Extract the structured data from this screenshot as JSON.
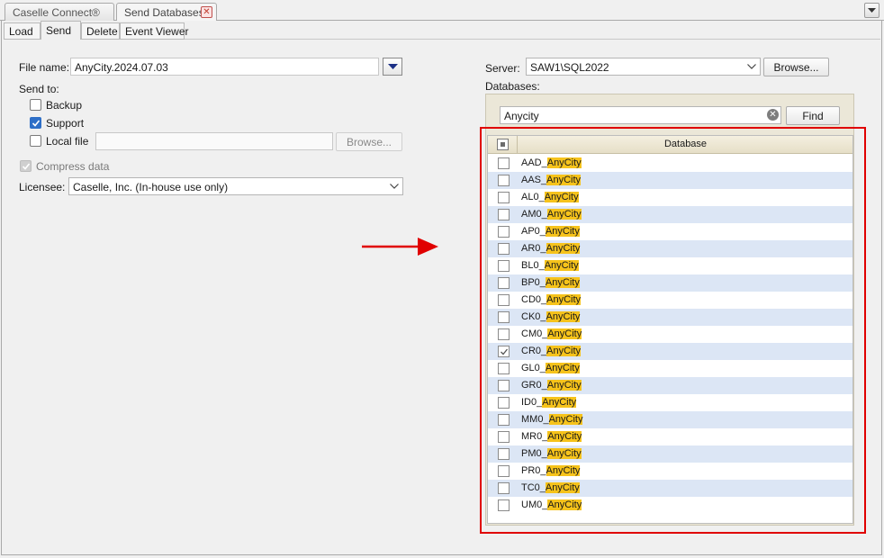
{
  "doc_tabs": [
    {
      "label": "Caselle Connect®"
    },
    {
      "label": "Send Databases"
    }
  ],
  "inner_tabs": [
    {
      "label": "Load"
    },
    {
      "label": "Send"
    },
    {
      "label": "Delete"
    },
    {
      "label": "Event Viewer"
    }
  ],
  "form": {
    "file_name_label": "File name:",
    "file_name_value": "AnyCity.2024.07.03",
    "send_to_label": "Send to:",
    "backup_label": "Backup",
    "backup_checked": false,
    "support_label": "Support",
    "support_checked": true,
    "local_file_label": "Local file",
    "local_file_checked": false,
    "local_file_value": "",
    "browse_label": "Browse...",
    "compress_label": "Compress data",
    "compress_checked": true,
    "licensee_label": "Licensee:",
    "licensee_value": "Caselle, Inc. (In-house use only)"
  },
  "server": {
    "label": "Server:",
    "value": "SAW1\\SQL2022",
    "browse_label": "Browse..."
  },
  "databases": {
    "label": "Databases:",
    "search_value": "Anycity",
    "find_label": "Find",
    "column_header": "Database",
    "highlight_color": "#f6c31b",
    "rows": [
      {
        "prefix": "AAD_",
        "match": "AnyCity",
        "checked": false
      },
      {
        "prefix": "AAS_",
        "match": "AnyCity",
        "checked": false
      },
      {
        "prefix": "AL0_",
        "match": "AnyCity",
        "checked": false
      },
      {
        "prefix": "AM0_",
        "match": "AnyCity",
        "checked": false
      },
      {
        "prefix": "AP0_",
        "match": "AnyCity",
        "checked": false
      },
      {
        "prefix": "AR0_",
        "match": "AnyCity",
        "checked": false
      },
      {
        "prefix": "BL0_",
        "match": "AnyCity",
        "checked": false
      },
      {
        "prefix": "BP0_",
        "match": "AnyCity",
        "checked": false
      },
      {
        "prefix": "CD0_",
        "match": "AnyCity",
        "checked": false
      },
      {
        "prefix": "CK0_",
        "match": "AnyCity",
        "checked": false
      },
      {
        "prefix": "CM0_",
        "match": "AnyCity",
        "checked": false
      },
      {
        "prefix": "CR0_",
        "match": "AnyCity",
        "checked": true
      },
      {
        "prefix": "GL0_",
        "match": "AnyCity",
        "checked": false
      },
      {
        "prefix": "GR0_",
        "match": "AnyCity",
        "checked": false
      },
      {
        "prefix": "ID0_",
        "match": "AnyCity",
        "checked": false
      },
      {
        "prefix": "MM0_",
        "match": "AnyCity",
        "checked": false
      },
      {
        "prefix": "MR0_",
        "match": "AnyCity",
        "checked": false
      },
      {
        "prefix": "PM0_",
        "match": "AnyCity",
        "checked": false
      },
      {
        "prefix": "PR0_",
        "match": "AnyCity",
        "checked": false
      },
      {
        "prefix": "TC0_",
        "match": "AnyCity",
        "checked": false
      },
      {
        "prefix": "UM0_",
        "match": "AnyCity",
        "checked": false
      }
    ]
  },
  "annotation": {
    "arrow_color": "#e00000",
    "frame_color": "#e00000"
  }
}
